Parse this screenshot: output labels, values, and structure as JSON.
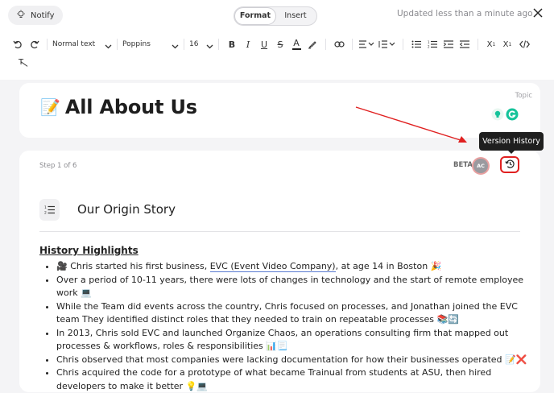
{
  "header": {
    "notify_label": "Notify",
    "tabs": [
      "Format",
      "Insert"
    ],
    "status": "Updated less than a minute ago"
  },
  "toolbar": {
    "paragraph_style": "Normal text",
    "font_family": "Poppins",
    "font_size": "16"
  },
  "title_card": {
    "topic_label": "Topic",
    "emoji": "📝",
    "title": "All About Us"
  },
  "step_card": {
    "step_label": "Step 1 of 6",
    "beta_label": "BETA",
    "avatar_initials": "AC",
    "tooltip": "Version History",
    "section_title": "Our Origin Story",
    "highlights_heading": "History Highlights",
    "bullets": [
      {
        "pre": "🎥 Chris started his first business, ",
        "link": "EVC (Event Video Company)",
        "post": ", at age 14 in Boston 🎉"
      },
      {
        "pre": "Over a period of 10-11 years, there were lots of changes in technology and the start of remote employee work 💻",
        "link": "",
        "post": ""
      },
      {
        "pre": "While the Team did events across the country, Chris focused on processes, and Jonathan joined the EVC team They identified distinct roles that they needed to train on repeatable processes 📚🔄",
        "link": "",
        "post": ""
      },
      {
        "pre": "In 2013, Chris sold EVC and launched Organize Chaos, an operations consulting firm that mapped out processes & workflows, roles & responsibilities 📊📃",
        "link": "",
        "post": ""
      },
      {
        "pre": "Chris observed that most companies were lacking documentation for how their businesses operated 📝❌",
        "link": "",
        "post": ""
      },
      {
        "pre": "Chris acquired the code for a prototype of what became Trainual from students at ASU, then hired developers to make it better 💡💻",
        "link": "",
        "post": ""
      }
    ]
  },
  "colors": {
    "accent_red": "#e02020",
    "tooltip_bg": "#1f1f1f",
    "grammarly_green": "#15c39a"
  }
}
